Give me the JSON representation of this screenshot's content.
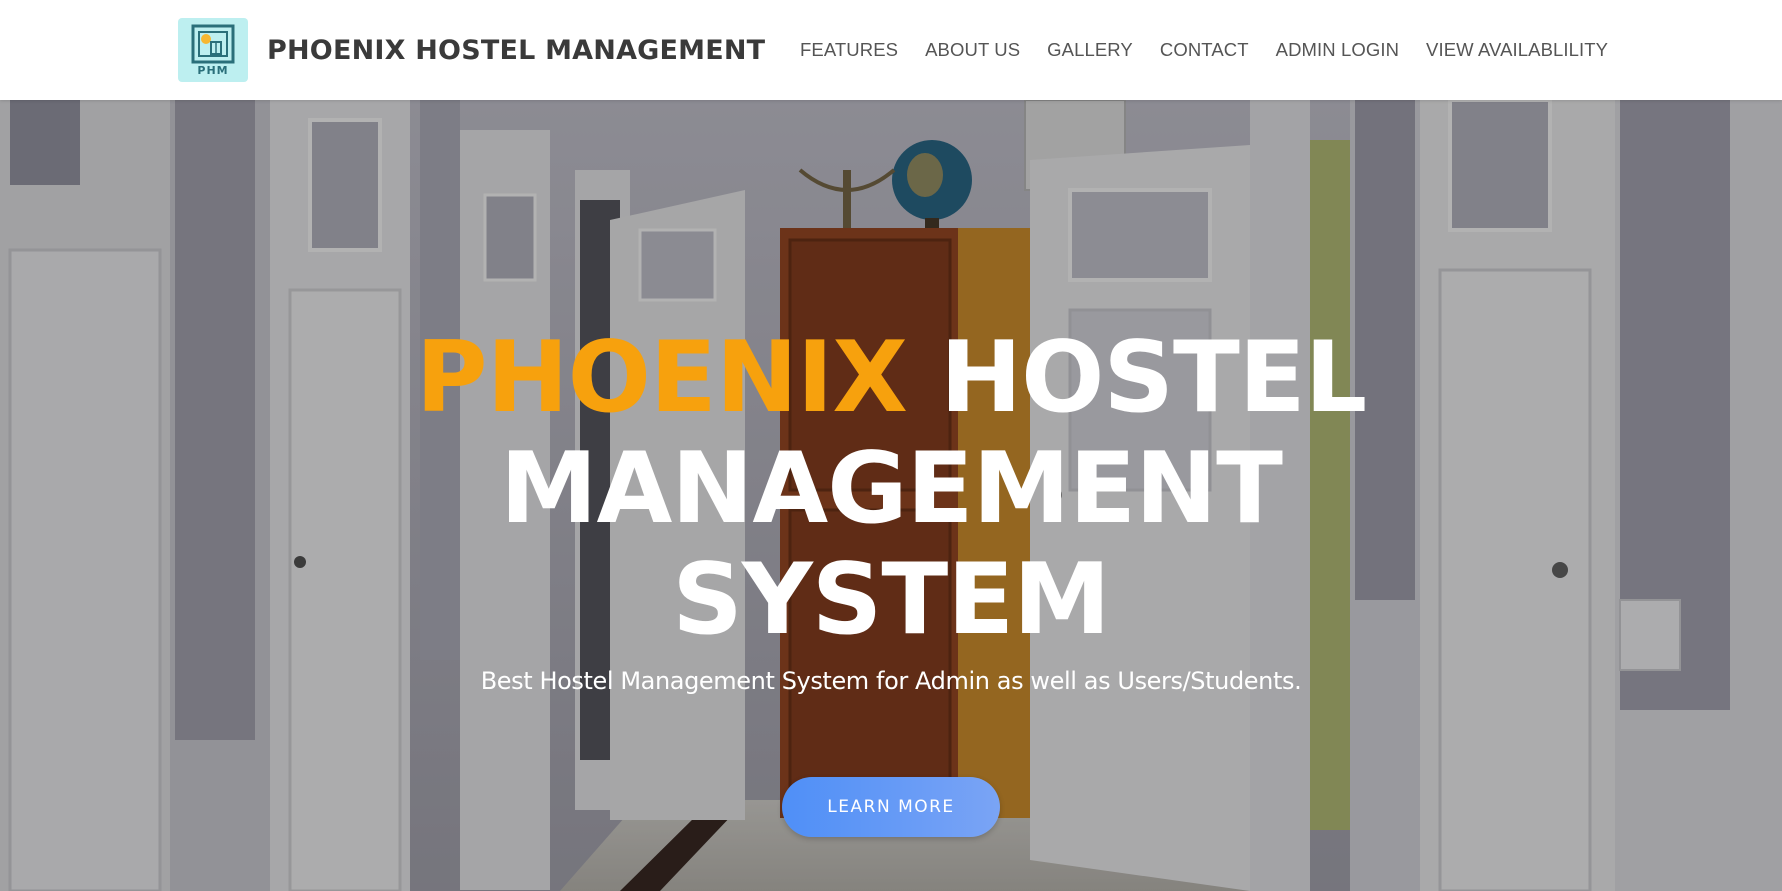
{
  "navbar": {
    "logo": {
      "icon": "building-logo-icon",
      "text": "PHM"
    },
    "brand": "PHOENIX HOSTEL MANAGEMENT",
    "links": [
      {
        "label": "FEATURES"
      },
      {
        "label": "ABOUT US"
      },
      {
        "label": "GALLERY"
      },
      {
        "label": "CONTACT"
      },
      {
        "label": "ADMIN LOGIN"
      },
      {
        "label": "VIEW AVAILABLILITY"
      }
    ]
  },
  "hero": {
    "background": "hostel-corridor-photo",
    "title_accent": "PHOENIX",
    "title_rest": "HOSTEL MANAGEMENT SYSTEM",
    "subtitle": "Best Hostel Management System for Admin as well as Users/Students.",
    "button_label": "LEARN MORE"
  },
  "colors": {
    "accent": "#f7a10d",
    "button_gradient_start": "#4f8ff7",
    "button_gradient_end": "#7aa4f5",
    "brand_text": "#3a3a3a",
    "nav_text": "#555555"
  }
}
